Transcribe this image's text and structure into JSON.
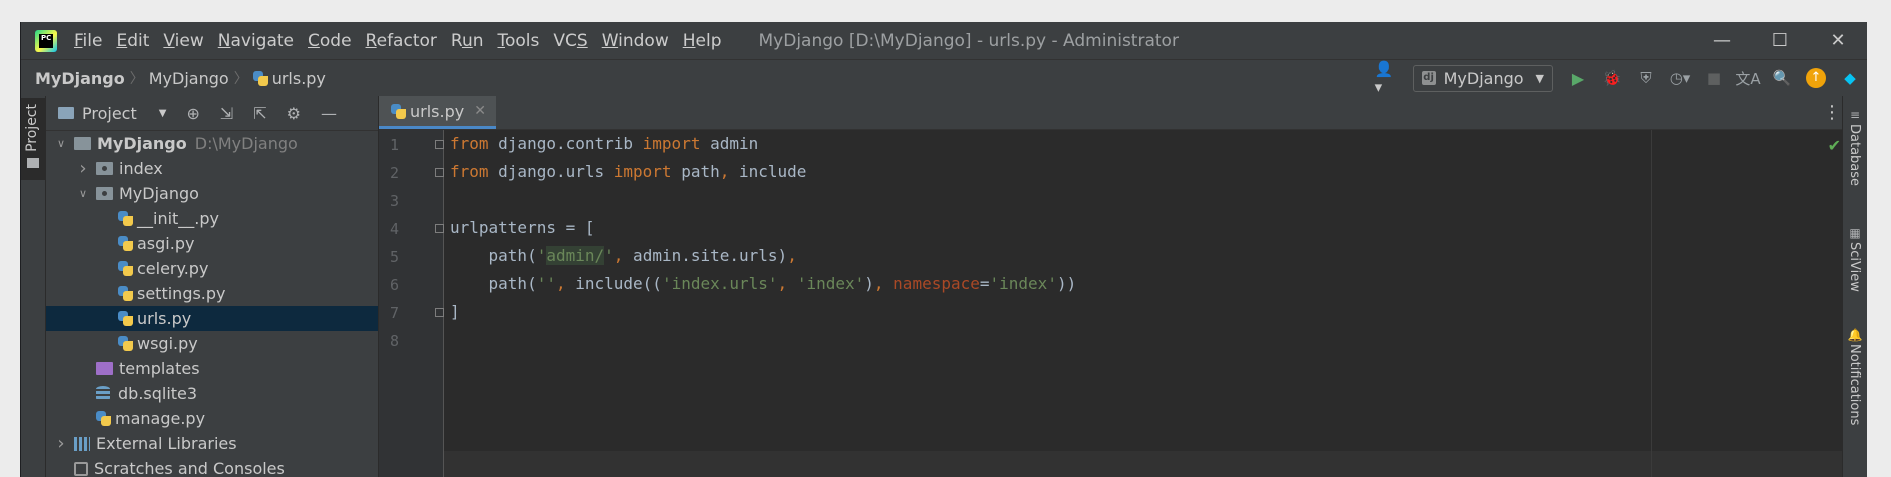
{
  "window": {
    "title": "MyDjango [D:\\MyDjango] - urls.py - Administrator",
    "logo_text": "PC"
  },
  "menu": [
    {
      "pre": "",
      "u": "F",
      "post": "ile"
    },
    {
      "pre": "",
      "u": "E",
      "post": "dit"
    },
    {
      "pre": "",
      "u": "V",
      "post": "iew"
    },
    {
      "pre": "",
      "u": "N",
      "post": "avigate"
    },
    {
      "pre": "",
      "u": "C",
      "post": "ode"
    },
    {
      "pre": "",
      "u": "R",
      "post": "efactor"
    },
    {
      "pre": "R",
      "u": "u",
      "post": "n"
    },
    {
      "pre": "",
      "u": "T",
      "post": "ools"
    },
    {
      "pre": "VC",
      "u": "S",
      "post": ""
    },
    {
      "pre": "",
      "u": "W",
      "post": "indow"
    },
    {
      "pre": "",
      "u": "H",
      "post": "elp"
    }
  ],
  "breadcrumbs": [
    "MyDjango",
    "MyDjango",
    "urls.py"
  ],
  "run_config": {
    "label": "MyDjango"
  },
  "left_strip": {
    "project_tab": "Project"
  },
  "project_panel": {
    "title": "Project",
    "tree": [
      {
        "label": "MyDjango",
        "extra": "D:\\MyDjango",
        "indent": 0,
        "arrow": "down",
        "icon": "folder",
        "bold": true
      },
      {
        "label": "index",
        "indent": 1,
        "arrow": "right",
        "icon": "folder-pkg"
      },
      {
        "label": "MyDjango",
        "indent": 1,
        "arrow": "down",
        "icon": "folder-pkg"
      },
      {
        "label": "__init__.py",
        "indent": 2,
        "icon": "python"
      },
      {
        "label": "asgi.py",
        "indent": 2,
        "icon": "python"
      },
      {
        "label": "celery.py",
        "indent": 2,
        "icon": "python"
      },
      {
        "label": "settings.py",
        "indent": 2,
        "icon": "python"
      },
      {
        "label": "urls.py",
        "indent": 2,
        "icon": "python",
        "selected": true
      },
      {
        "label": "wsgi.py",
        "indent": 2,
        "icon": "python"
      },
      {
        "label": "templates",
        "indent": 1,
        "icon": "folder-purple"
      },
      {
        "label": "db.sqlite3",
        "indent": 1,
        "icon": "db"
      },
      {
        "label": "manage.py",
        "indent": 1,
        "icon": "python"
      },
      {
        "label": "External Libraries",
        "indent": 0,
        "arrow": "right",
        "icon": "lib"
      },
      {
        "label": "Scratches and Consoles",
        "indent": 0,
        "icon": "scratch"
      }
    ]
  },
  "editor": {
    "tab": "urls.py",
    "lines": [
      [
        [
          "kw",
          "from"
        ],
        [
          "t",
          " django.contrib "
        ],
        [
          "kw",
          "import"
        ],
        [
          "t",
          " admin"
        ]
      ],
      [
        [
          "kw",
          "from"
        ],
        [
          "t",
          " django.urls "
        ],
        [
          "kw",
          "import"
        ],
        [
          "t",
          " path"
        ],
        [
          "pn",
          ","
        ],
        [
          "t",
          " include"
        ]
      ],
      [],
      [
        [
          "t",
          "urlpatterns = ["
        ]
      ],
      [
        [
          "t",
          "    path("
        ],
        [
          "st",
          "'"
        ],
        [
          "sth",
          "admin/"
        ],
        [
          "st",
          "'"
        ],
        [
          "pn",
          ","
        ],
        [
          "t",
          " admin.site.urls)"
        ],
        [
          "pn",
          ","
        ]
      ],
      [
        [
          "t",
          "    path("
        ],
        [
          "st",
          "''"
        ],
        [
          "pn",
          ","
        ],
        [
          "t",
          " include(("
        ],
        [
          "st",
          "'index.urls'"
        ],
        [
          "pn",
          ","
        ],
        [
          "t",
          " "
        ],
        [
          "st",
          "'index'"
        ],
        [
          "t",
          ")"
        ],
        [
          "pn",
          ","
        ],
        [
          "t",
          " "
        ],
        [
          "nm",
          "namespace"
        ],
        [
          "t",
          "="
        ],
        [
          "st",
          "'index'"
        ],
        [
          "t",
          "))"
        ]
      ],
      [
        [
          "t",
          "]"
        ]
      ],
      []
    ],
    "line_numbers": [
      "1",
      "2",
      "3",
      "4",
      "5",
      "6",
      "7",
      "8"
    ]
  },
  "right_strip": [
    "Database",
    "SciView",
    "Notifications"
  ],
  "colors": {
    "keyword": "#cc7832",
    "string": "#6a8759",
    "named_arg": "#aa4926",
    "text": "#a9b7c6",
    "selection": "#0d293e"
  }
}
